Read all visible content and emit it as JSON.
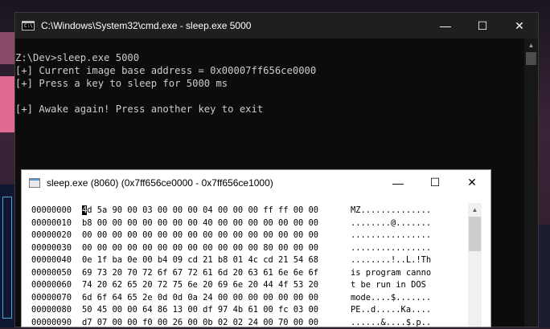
{
  "cmd": {
    "title": "C:\\Windows\\System32\\cmd.exe - sleep.exe  5000",
    "icon": "cmd-app-icon",
    "icon_text": "C:\\",
    "controls": {
      "minimize": "—",
      "maximize": "☐",
      "close": "✕"
    },
    "lines": [
      "Z:\\Dev>sleep.exe 5000",
      "[+] Current image base address = 0x00007ff656ce0000",
      "[+] Press a key to sleep for 5000 ms",
      "",
      "[+] Awake again! Press another key to exit"
    ],
    "scroll_up_arrow": "▲"
  },
  "hexviewer": {
    "title": "sleep.exe (8060) (0x7ff656ce0000 - 0x7ff656ce1000)",
    "icon": "window-icon",
    "controls": {
      "minimize": "—",
      "maximize": "☐",
      "close": "✕"
    },
    "scroll_up_arrow": "▲",
    "cursor_char": "4",
    "first_row_rest": "d 5a 90 00 03 00 00 00 04 00 00 00 ff ff 00 00",
    "rows": [
      {
        "offset": "00000000",
        "bytes": "4d 5a 90 00 03 00 00 00 04 00 00 00 ff ff 00 00",
        "ascii": "MZ.............."
      },
      {
        "offset": "00000010",
        "bytes": "b8 00 00 00 00 00 00 00 40 00 00 00 00 00 00 00",
        "ascii": "........@......."
      },
      {
        "offset": "00000020",
        "bytes": "00 00 00 00 00 00 00 00 00 00 00 00 00 00 00 00",
        "ascii": "................"
      },
      {
        "offset": "00000030",
        "bytes": "00 00 00 00 00 00 00 00 00 00 00 00 80 00 00 00",
        "ascii": "................"
      },
      {
        "offset": "00000040",
        "bytes": "0e 1f ba 0e 00 b4 09 cd 21 b8 01 4c cd 21 54 68",
        "ascii": "........!..L.!Th"
      },
      {
        "offset": "00000050",
        "bytes": "69 73 20 70 72 6f 67 72 61 6d 20 63 61 6e 6e 6f",
        "ascii": "is program canno"
      },
      {
        "offset": "00000060",
        "bytes": "74 20 62 65 20 72 75 6e 20 69 6e 20 44 4f 53 20",
        "ascii": "t be run in DOS "
      },
      {
        "offset": "00000070",
        "bytes": "6d 6f 64 65 2e 0d 0d 0a 24 00 00 00 00 00 00 00",
        "ascii": "mode....$......."
      },
      {
        "offset": "00000080",
        "bytes": "50 45 00 00 64 86 13 00 df 97 4b 61 00 fc 03 00",
        "ascii": "PE..d.....Ka...."
      },
      {
        "offset": "00000090",
        "bytes": "d7 07 00 00 f0 00 26 00 0b 02 02 24 00 70 00 00",
        "ascii": "......&....$.p.."
      }
    ]
  }
}
